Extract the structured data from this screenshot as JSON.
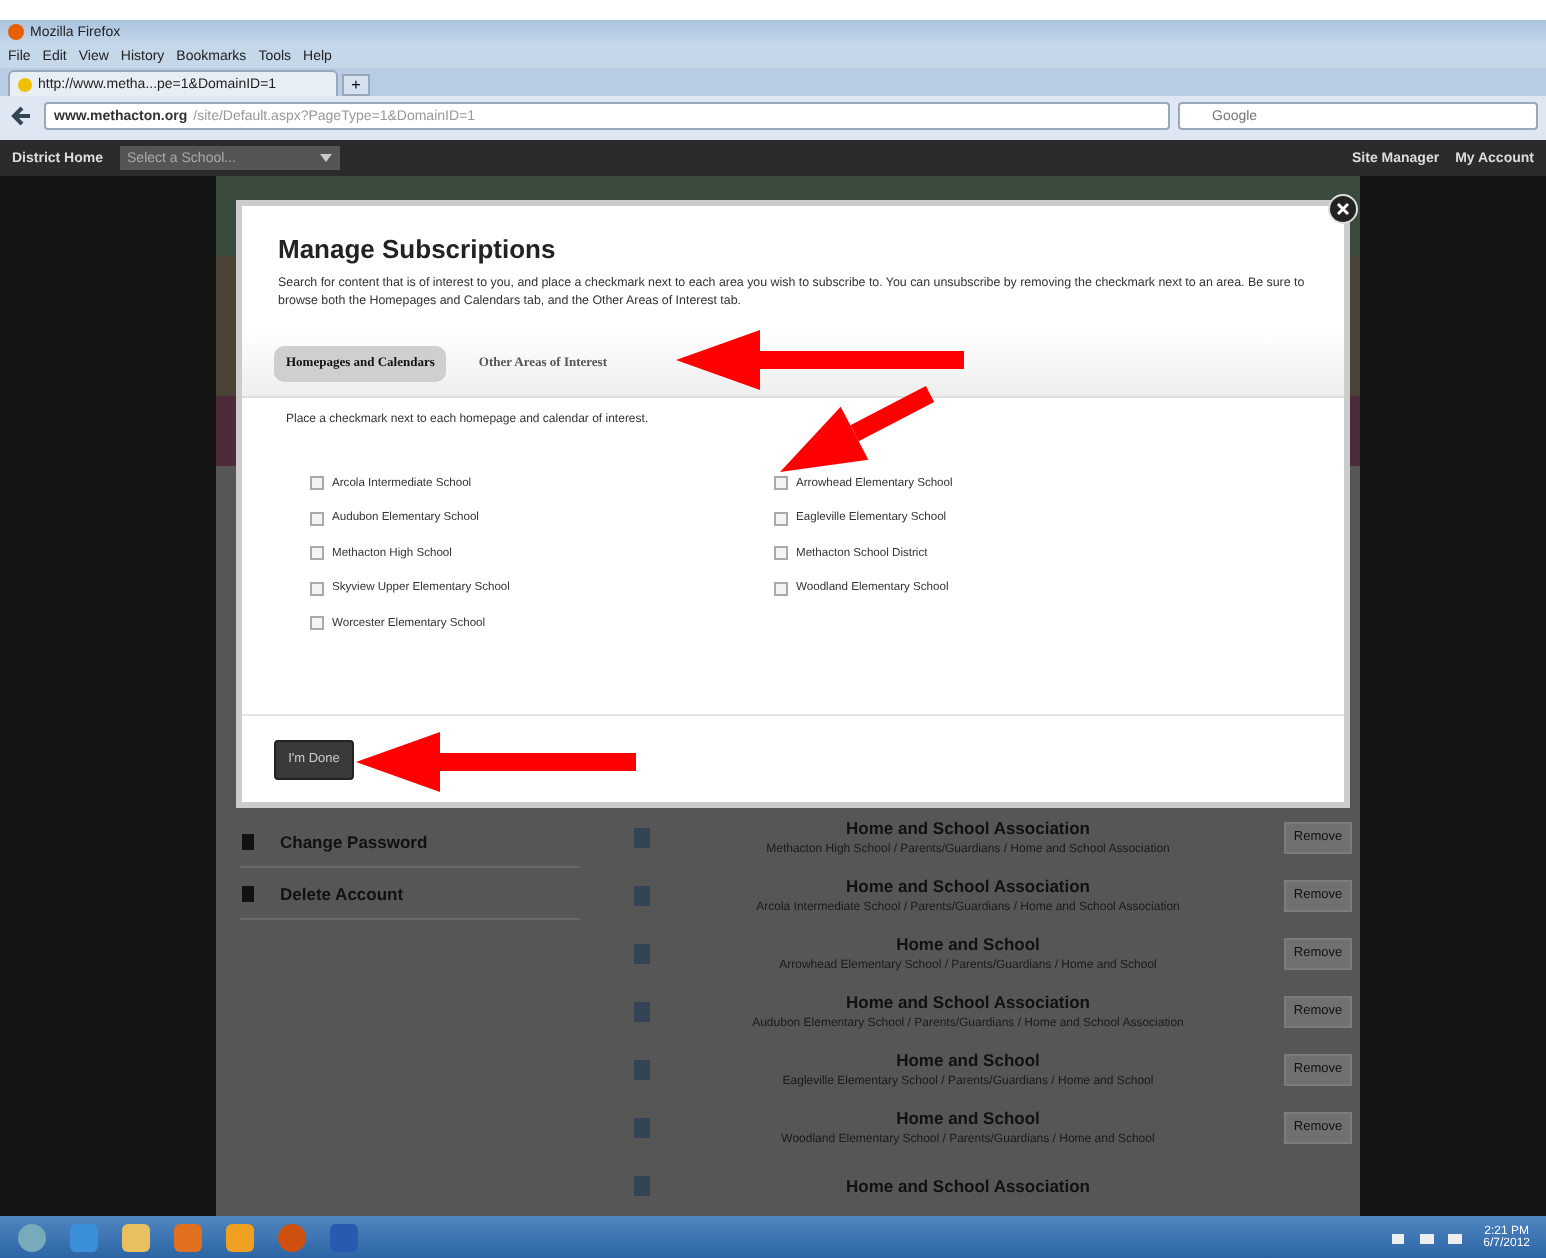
{
  "window": {
    "title": "Mozilla Firefox"
  },
  "menu": [
    "File",
    "Edit",
    "View",
    "History",
    "Bookmarks",
    "Tools",
    "Help"
  ],
  "browser_tab": {
    "title": "http://www.metha...pe=1&DomainID=1",
    "new_tab": "+"
  },
  "address_bar": {
    "domain": "www.methacton.org",
    "path": "/site/Default.aspx?PageType=1&DomainID=1"
  },
  "search": {
    "placeholder": "Google"
  },
  "site_nav": {
    "home": "District Home",
    "school_select": "Select a School...",
    "links": [
      "Site Manager",
      "My Account"
    ]
  },
  "account_menu": [
    "Change Password",
    "Delete Account"
  ],
  "subscriptions": [
    {
      "title": "Home and School Association",
      "path": "Methacton High School / Parents/Guardians / Home and School Association",
      "action": "Remove"
    },
    {
      "title": "Home and School Association",
      "path": "Arcola Intermediate School / Parents/Guardians / Home and School Association",
      "action": "Remove"
    },
    {
      "title": "Home and School",
      "path": "Arrowhead Elementary School / Parents/Guardians / Home and School",
      "action": "Remove"
    },
    {
      "title": "Home and School Association",
      "path": "Audubon Elementary School / Parents/Guardians / Home and School Association",
      "action": "Remove"
    },
    {
      "title": "Home and School",
      "path": "Eagleville Elementary School / Parents/Guardians / Home and School",
      "action": "Remove"
    },
    {
      "title": "Home and School",
      "path": "Woodland Elementary School / Parents/Guardians / Home and School",
      "action": "Remove"
    },
    {
      "title": "Home and School Association"
    }
  ],
  "dialog": {
    "title": "Manage Subscriptions",
    "description": "Search for content that is of interest to you, and place a checkmark next to each area you wish to subscribe to. You can unsubscribe by removing the checkmark next to an area. Be sure to browse both the Homepages and Calendars tab, and the Other Areas of Interest tab.",
    "tabs": [
      {
        "label": "Homepages and Calendars",
        "selected": true
      },
      {
        "label": "Other Areas of Interest",
        "selected": false
      }
    ],
    "instruction": "Place a checkmark next to each homepage and calendar of interest.",
    "options": [
      {
        "label": "Arcola Intermediate School",
        "checked": false
      },
      {
        "label": "Audubon Elementary School",
        "checked": false
      },
      {
        "label": "Methacton High School",
        "checked": false
      },
      {
        "label": "Skyview Upper Elementary School",
        "checked": false
      },
      {
        "label": "Worcester Elementary School",
        "checked": false
      },
      {
        "label": "Arrowhead Elementary School",
        "checked": false
      },
      {
        "label": "Eagleville Elementary School",
        "checked": false
      },
      {
        "label": "Methacton School District",
        "checked": false
      },
      {
        "label": "Woodland Elementary School",
        "checked": false
      }
    ],
    "done_button": "I'm Done"
  },
  "taskbar": {
    "time": "2:21 PM",
    "date": "6/7/2012"
  }
}
